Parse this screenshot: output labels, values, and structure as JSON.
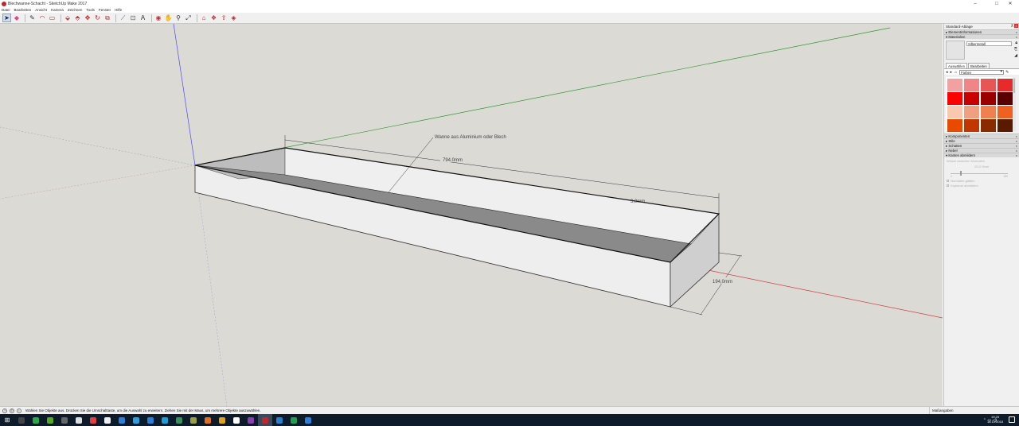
{
  "window": {
    "title": "Blechwanne-Schacht - SketchUp Make 2017",
    "minimize": "–",
    "maximize": "□",
    "close": "✕"
  },
  "menu": [
    "Datei",
    "Bearbeiten",
    "Ansicht",
    "Kamera",
    "Zeichnen",
    "Tools",
    "Fenster",
    "Hilfe"
  ],
  "toolbar": {
    "tools": [
      {
        "name": "select-tool-icon",
        "glyph": "➤",
        "color": "#222",
        "active": true
      },
      {
        "name": "eraser-tool-icon",
        "glyph": "◆",
        "color": "#d84a8a"
      },
      {
        "name": "pencil-tool-icon",
        "glyph": "✎",
        "color": "#333"
      },
      {
        "name": "arc-tool-icon",
        "glyph": "◠",
        "color": "#a33"
      },
      {
        "name": "rectangle-tool-icon",
        "glyph": "▭",
        "color": "#7a4a2a"
      },
      {
        "name": "push-pull-tool-icon",
        "glyph": "⬙",
        "color": "#c04040"
      },
      {
        "name": "follow-me-tool-icon",
        "glyph": "⬘",
        "color": "#b03030"
      },
      {
        "name": "move-tool-icon",
        "glyph": "✥",
        "color": "#c02020"
      },
      {
        "name": "rotate-tool-icon",
        "glyph": "↻",
        "color": "#c02020"
      },
      {
        "name": "scale-tool-icon",
        "glyph": "⧉",
        "color": "#c03030"
      },
      {
        "name": "tape-measure-tool-icon",
        "glyph": "⟋",
        "color": "#555"
      },
      {
        "name": "dimension-tool-icon",
        "glyph": "⊡",
        "color": "#555"
      },
      {
        "name": "text-tool-icon",
        "glyph": "A",
        "color": "#333"
      },
      {
        "name": "orbit-tool-icon",
        "glyph": "◉",
        "color": "#c03030"
      },
      {
        "name": "pan-tool-icon",
        "glyph": "✋",
        "color": "#b07030"
      },
      {
        "name": "zoom-tool-icon",
        "glyph": "⚲",
        "color": "#333"
      },
      {
        "name": "zoom-extents-icon",
        "glyph": "⤢",
        "color": "#333"
      },
      {
        "name": "warehouse-icon",
        "glyph": "⌂",
        "color": "#c02020"
      },
      {
        "name": "extension-warehouse-icon",
        "glyph": "❖",
        "color": "#a33"
      },
      {
        "name": "share-model-icon",
        "glyph": "⇪",
        "color": "#c02020"
      },
      {
        "name": "layout-icon",
        "glyph": "◈",
        "color": "#a22"
      }
    ]
  },
  "viewport": {
    "label_text": "Wanne aus Aluminium oder Blech",
    "dim_length": "794,0mm",
    "dim_width": "194,0mm",
    "dim_thickness": "3,0mm"
  },
  "tray": {
    "title": "Standard-Ablage",
    "sections_top": [
      "Elementinformationen",
      "Materialien"
    ],
    "material_name": "Silbermetall",
    "tabs": [
      "Auswählen",
      "Bearbeiten"
    ],
    "collection": "Farben",
    "colors": [
      "#f2a0a0",
      "#f08585",
      "#e85555",
      "#e82a2a",
      "#ff0000",
      "#c80000",
      "#9a0000",
      "#5a0000",
      "#f8c8b0",
      "#f0a080",
      "#f08050",
      "#f06020",
      "#e84a00",
      "#c03800",
      "#8a2a00",
      "#5a1a00"
    ],
    "sections_bottom": [
      "Komponenten",
      "Stile",
      "Schatten",
      "Nebel",
      "Kanten abmildern"
    ],
    "soften_label": "Winkel zwischen Normalen",
    "soften_value": "20,0  Grad",
    "slider_min": "0",
    "slider_max": "180",
    "smooth_normals": "Normalen glätten",
    "soften_coplanar": "Koplanar abmildern"
  },
  "status": {
    "text": "Wählen Sie Objekte aus. Drücken Sie die Umschalttaste, um die Auswahl zu erweitern. Ziehen Sie mit der Maus, um mehrere Objekte auszuwählen.",
    "measurements_label": "Maßangaben"
  },
  "taskbar": {
    "apps": [
      "#444",
      "#2aa84a",
      "#55aa22",
      "#666",
      "#ddd",
      "#e04040",
      "#eee",
      "#2f7fd8",
      "#2aa0e0",
      "#2a7fd8",
      "#1a9fd8",
      "#3a8f5a",
      "#9aa040",
      "#e07020",
      "#e0a020",
      "#ffffff",
      "#8a40b0",
      "#c0272d",
      "#2a80d0",
      "#1fa050",
      "#2a7fd8"
    ],
    "time": "19:25",
    "date": "18.10.2018"
  }
}
